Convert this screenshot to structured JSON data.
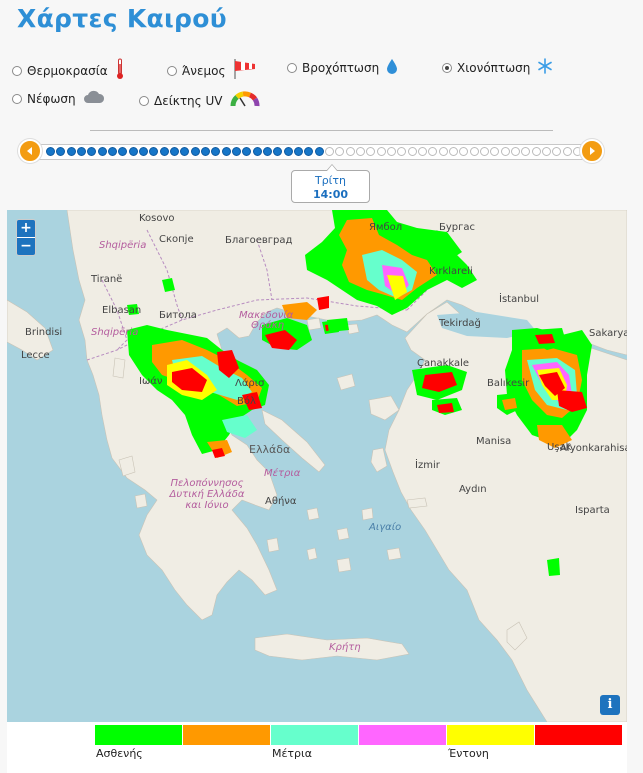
{
  "title": "Χάρτες Καιρού",
  "layers": [
    {
      "label": "Θερμοκρασία",
      "icon": "thermometer-icon",
      "checked": false
    },
    {
      "label": "Άνεμος",
      "icon": "windsock-icon",
      "checked": false
    },
    {
      "label": "Βροχόπτωση",
      "icon": "raindrop-icon",
      "checked": false
    },
    {
      "label": "Χιονόπτωση",
      "icon": "snowflake-icon",
      "checked": true
    },
    {
      "label": "Νέφωση",
      "icon": "cloud-icon",
      "checked": false
    },
    {
      "label": "Δείκτης UV",
      "icon": "uv-gauge-icon",
      "checked": false
    }
  ],
  "timeline": {
    "total_steps": 52,
    "current_step": 27,
    "day": "Τρίτη",
    "time": "14:00",
    "prev_icon": "chevron-left-icon",
    "next_icon": "chevron-right-icon"
  },
  "map": {
    "zoom_in": "+",
    "zoom_out": "−",
    "info": "i",
    "labels": {
      "kosovo": "Kosovo",
      "skopje": "Скопје",
      "blagoevgrad": "Благоевград",
      "yambol": "Ямбол",
      "burgas": "Бургас",
      "shqiperia_top": "Shqipëria",
      "tirane": "Tiranë",
      "elbasan": "Elbasan",
      "shqiperia": "Shqipëria",
      "brindisi": "Brindisi",
      "lecce": "Lecce",
      "bitola": "Битола",
      "makedonia": "Μακεδονία",
      "thraki": "Θράκη",
      "kirklareli": "Kırklareli",
      "istanbul": "İstanbul",
      "tekirdag": "Tekirdağ",
      "sakarya": "Sakarya",
      "canakkale": "Çanakkale",
      "balikesir": "Balıkesir",
      "ioannina": "Ιωάν",
      "larisa": "Λάρισ",
      "volos": "Βόλ",
      "ellada": "Ελλάδα",
      "izmir": "İzmir",
      "manisa": "Manisa",
      "usak": "Uşak",
      "afyonkarahisar": "Afyonkarahisar",
      "peloponnisos": "Πελοπόννησος Δυτική Ελλάδα και Ιόνιο",
      "athina": "Αθήνα",
      "metria_map": "Μέτρια",
      "aigaio": "Αιγαίο",
      "aydin": "Aydın",
      "isparta": "Isparta",
      "kriti": "Κρήτη"
    }
  },
  "legend": {
    "colors": [
      "#00ff00",
      "#ff9900",
      "#66ffcc",
      "#ff66ff",
      "#ffff00",
      "#ff0000"
    ],
    "labels": {
      "low": "Ασθενής",
      "mid": "Μέτρια",
      "high": "Έντονη"
    }
  }
}
